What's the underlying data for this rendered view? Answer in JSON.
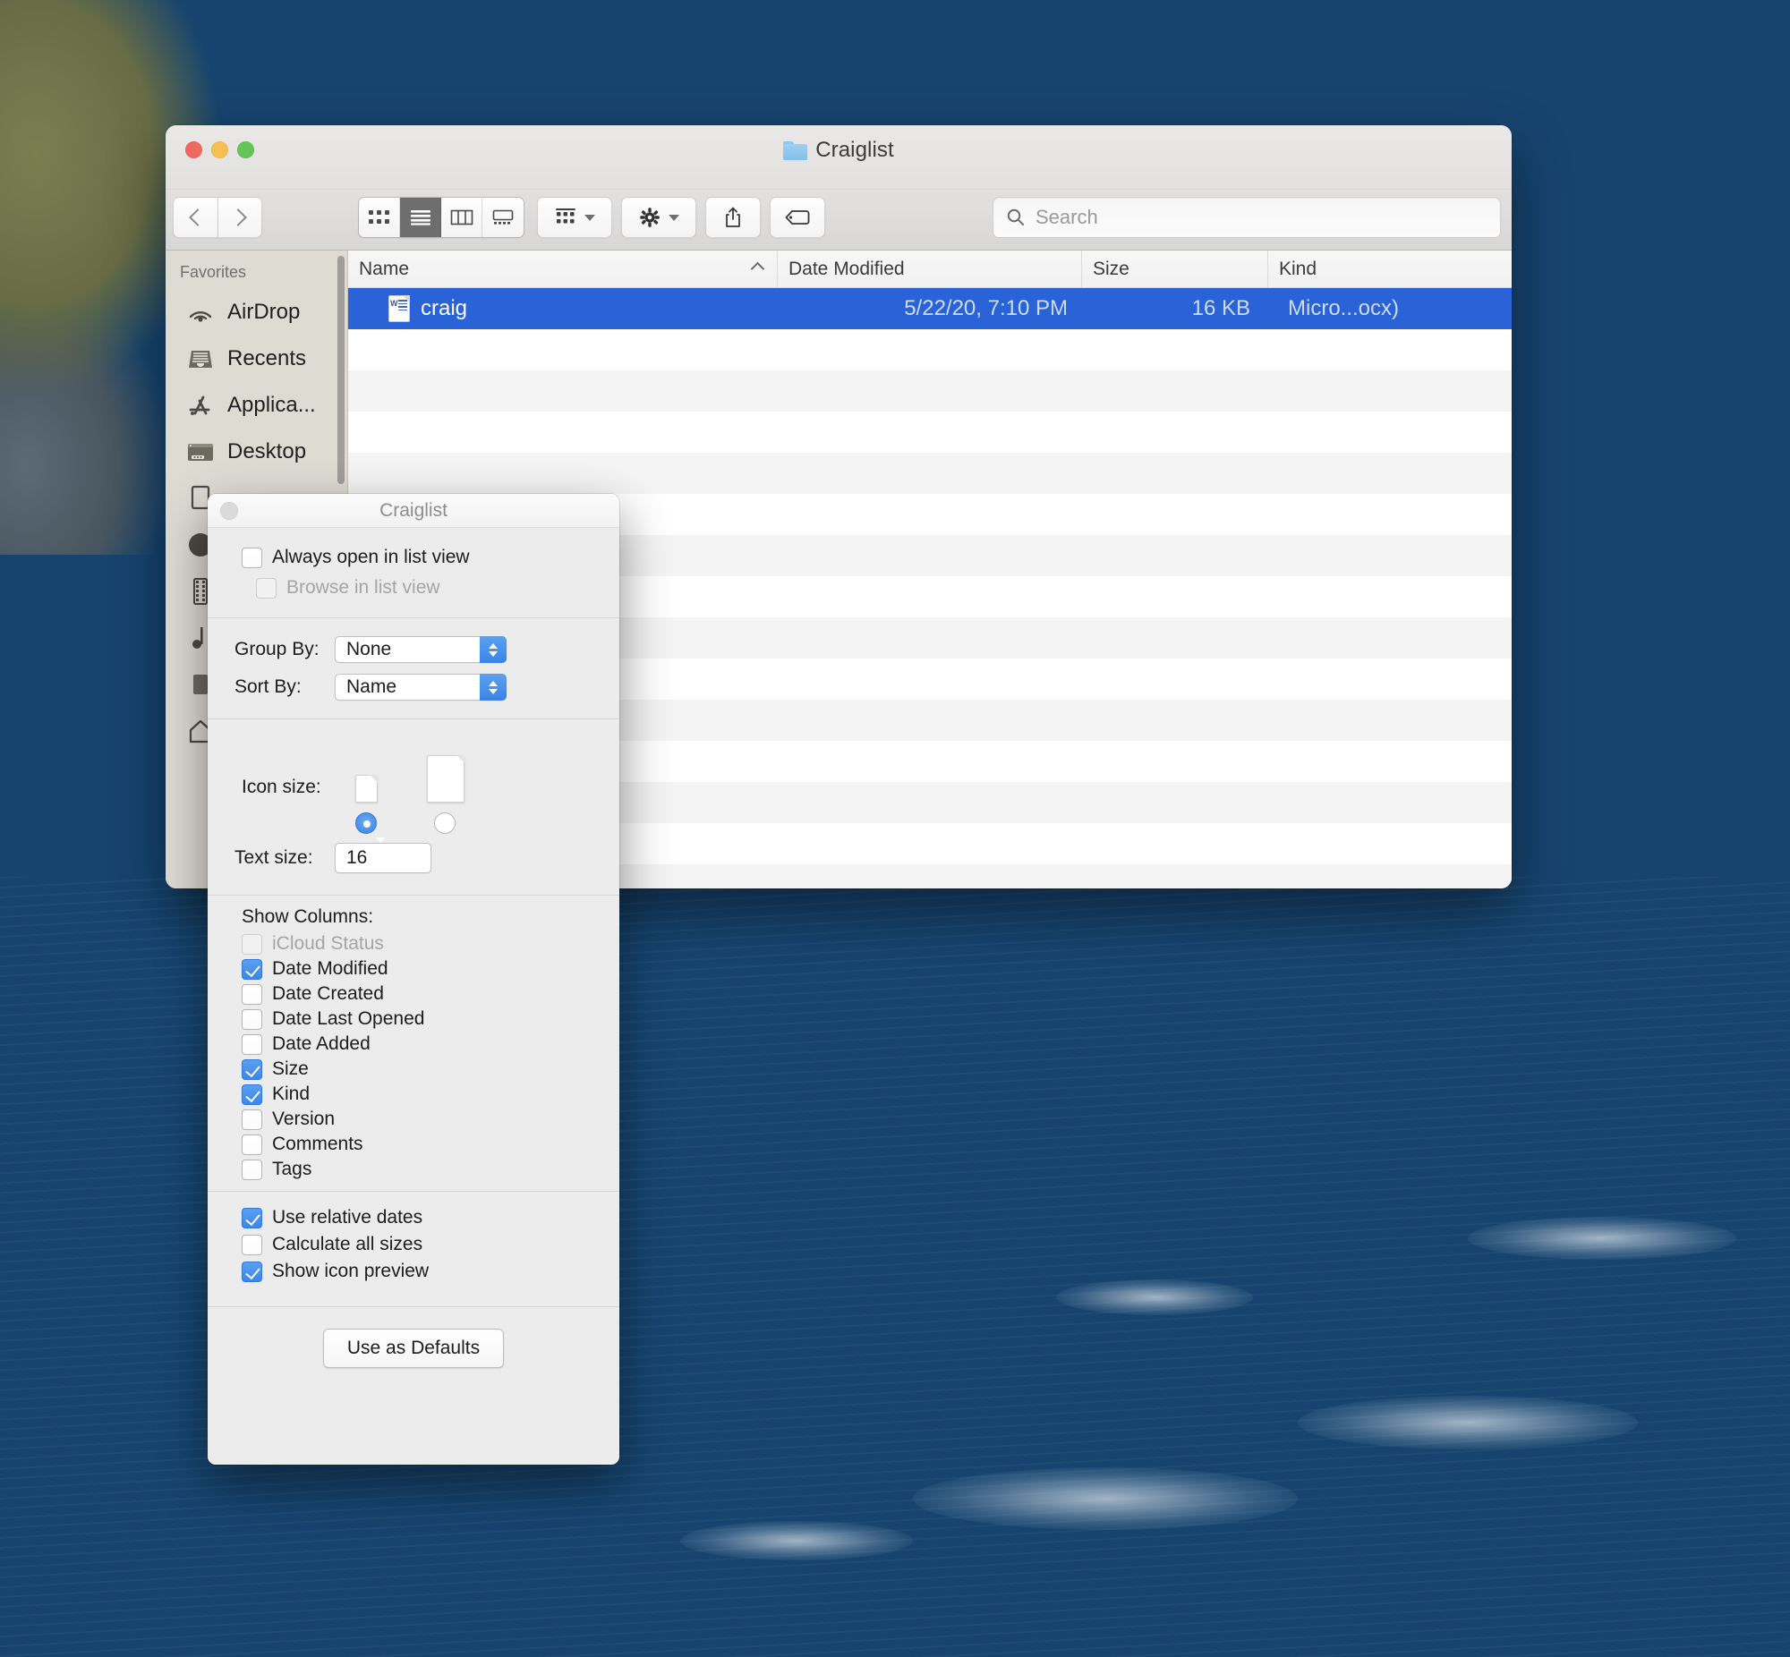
{
  "desktop": {
    "wallpaper_name": "catalina-coast-wallpaper"
  },
  "finder": {
    "window_title": "Craiglist",
    "title_icon": "folder-icon",
    "traffic_lights": [
      {
        "name": "close",
        "color": "#ec6a5f"
      },
      {
        "name": "minimize",
        "color": "#f5c04f"
      },
      {
        "name": "zoom",
        "color": "#62c555"
      }
    ],
    "toolbar": {
      "back_icon": "chevron-left-icon",
      "forward_icon": "chevron-right-icon",
      "view_modes": [
        {
          "name": "icon-view",
          "icon": "grid-icon",
          "active": false
        },
        {
          "name": "list-view",
          "icon": "list-icon",
          "active": true
        },
        {
          "name": "column-view",
          "icon": "columns-icon",
          "active": false
        },
        {
          "name": "gallery-view",
          "icon": "gallery-icon",
          "active": false
        }
      ],
      "group_button": {
        "icon": "group-rows-icon",
        "caret": "chevron-down-icon"
      },
      "action_button": {
        "icon": "gear-icon",
        "caret": "chevron-down-icon"
      },
      "share_button": {
        "icon": "share-icon"
      },
      "tag_button": {
        "icon": "tag-icon"
      },
      "search": {
        "placeholder": "Search",
        "value": "",
        "icon": "search-icon"
      }
    },
    "sidebar": {
      "section_label": "Favorites",
      "items": [
        {
          "label": "AirDrop",
          "icon": "airdrop-icon"
        },
        {
          "label": "Recents",
          "icon": "recents-icon"
        },
        {
          "label": "Applica...",
          "icon": "applications-icon"
        },
        {
          "label": "Desktop",
          "icon": "desktop-icon"
        }
      ]
    },
    "file_list": {
      "columns": [
        {
          "label": "Name",
          "sorted": true,
          "sort_direction": "ascending"
        },
        {
          "label": "Date Modified",
          "sorted": false
        },
        {
          "label": "Size",
          "sorted": false
        },
        {
          "label": "Kind",
          "sorted": false
        }
      ],
      "rows": [
        {
          "name": "craig",
          "icon": "word-document-icon",
          "date_modified": "5/22/20, 7:10 PM",
          "size": "16 KB",
          "kind": "Micro...ocx)",
          "selected": true
        }
      ],
      "empty_row_count": 14,
      "selection_color": "#2a62d8"
    }
  },
  "view_options": {
    "title": "Craiglist",
    "close_icon": "close-icon",
    "top_checkboxes": [
      {
        "label": "Always open in list view",
        "checked": false,
        "disabled": false
      },
      {
        "label": "Browse in list view",
        "checked": false,
        "disabled": true
      }
    ],
    "group_by": {
      "label": "Group By:",
      "value": "None"
    },
    "sort_by": {
      "label": "Sort By:",
      "value": "Name"
    },
    "icon_size": {
      "label": "Icon size:",
      "options": [
        {
          "name": "small",
          "selected": true
        },
        {
          "name": "large",
          "selected": false
        }
      ]
    },
    "text_size": {
      "label": "Text size:",
      "value": "16"
    },
    "show_columns": {
      "label": "Show Columns:",
      "items": [
        {
          "label": "iCloud Status",
          "checked": false,
          "disabled": true
        },
        {
          "label": "Date Modified",
          "checked": true,
          "disabled": false
        },
        {
          "label": "Date Created",
          "checked": false,
          "disabled": false
        },
        {
          "label": "Date Last Opened",
          "checked": false,
          "disabled": false
        },
        {
          "label": "Date Added",
          "checked": false,
          "disabled": false
        },
        {
          "label": "Size",
          "checked": true,
          "disabled": false
        },
        {
          "label": "Kind",
          "checked": true,
          "disabled": false
        },
        {
          "label": "Version",
          "checked": false,
          "disabled": false
        },
        {
          "label": "Comments",
          "checked": false,
          "disabled": false
        },
        {
          "label": "Tags",
          "checked": false,
          "disabled": false
        }
      ]
    },
    "options": [
      {
        "label": "Use relative dates",
        "checked": true
      },
      {
        "label": "Calculate all sizes",
        "checked": false
      },
      {
        "label": "Show icon preview",
        "checked": true
      }
    ],
    "use_as_defaults_label": "Use as Defaults"
  },
  "colors": {
    "accent_blue": "#3d86e8",
    "selection_blue": "#2a62d8",
    "window_chrome": "#e2e1e0",
    "sidebar_bg": "#dedbd3",
    "dialog_bg": "#ececec"
  }
}
